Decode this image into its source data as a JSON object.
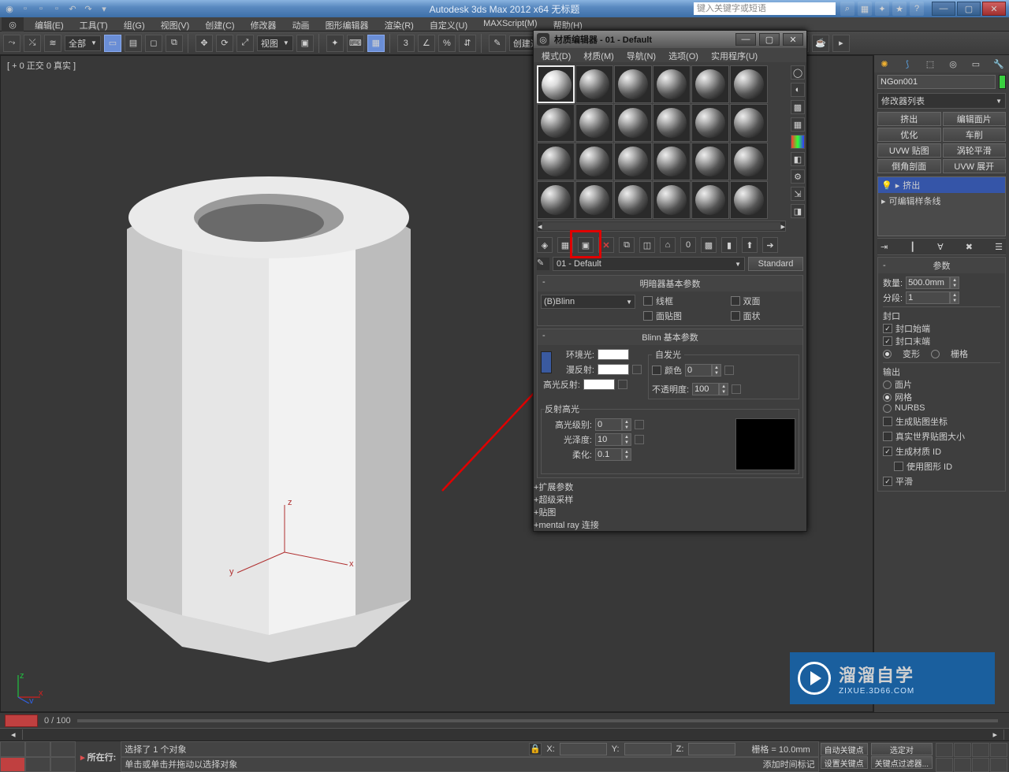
{
  "app": {
    "title": "Autodesk 3ds Max  2012 x64    无标题",
    "search_placeholder": "键入关键字或短语"
  },
  "menu": [
    "编辑(E)",
    "工具(T)",
    "组(G)",
    "视图(V)",
    "创建(C)",
    "修改器",
    "动画",
    "图形编辑器",
    "渲染(R)",
    "自定义(U)",
    "MAXScript(M)",
    "帮助(H)"
  ],
  "toolbar": {
    "all": "全部",
    "view": "视图",
    "create_set": "创建选择集"
  },
  "viewport": {
    "label": "[ + 0 正交 0 真实 ]"
  },
  "right": {
    "obj_name": "NGon001",
    "mod_list": "修改器列表",
    "btn_extrude": "挤出",
    "btn_editface": "编辑面片",
    "btn_optimize": "优化",
    "btn_lathe": "车削",
    "btn_uvwmap": "UVW 贴图",
    "btn_turbosmooth": "涡轮平滑",
    "btn_bevelprof": "倒角剖面",
    "btn_uvwunwrap": "UVW 展开",
    "stack_top": "挤出",
    "stack_base": "可编辑样条线",
    "rollup_params": "参数",
    "amount": "数量:",
    "amount_val": "500.0mm",
    "segs": "分段:",
    "segs_val": "1",
    "cap": "封口",
    "cap_start": "封口始端",
    "cap_end": "封口末端",
    "morph": "变形",
    "grid": "栅格",
    "output": "输出",
    "patch": "面片",
    "mesh": "网格",
    "nurbs": "NURBS",
    "gen_uv": "生成贴图坐标",
    "real_world": "真实世界贴图大小",
    "gen_matid": "生成材质 ID",
    "use_shapeid": "使用图形 ID",
    "smooth": "平滑"
  },
  "mat": {
    "title": "材质编辑器 - 01 - Default",
    "menu": [
      "模式(D)",
      "材质(M)",
      "导航(N)",
      "选项(O)",
      "实用程序(U)"
    ],
    "name": "01 - Default",
    "type": "Standard",
    "roll_shader": "明暗器基本参数",
    "shader": "(B)Blinn",
    "wire": "线框",
    "twoside": "双面",
    "facemap": "面贴图",
    "faceted": "面状",
    "roll_blinn": "Blinn 基本参数",
    "selfillum": "自发光",
    "color": "颜色",
    "color_val": "0",
    "ambient": "环境光:",
    "diffuse": "漫反射:",
    "specular": "高光反射:",
    "opacity": "不透明度:",
    "opacity_val": "100",
    "spec_hl": "反射高光",
    "spec_level": "高光级别:",
    "spec_level_val": "0",
    "gloss": "光泽度:",
    "gloss_val": "10",
    "soften": "柔化:",
    "soften_val": "0.1",
    "roll_ext": "扩展参数",
    "roll_ss": "超级采样",
    "roll_maps": "贴图",
    "roll_mr": "mental ray 连接"
  },
  "timeline": {
    "range": "0 / 100"
  },
  "status": {
    "selected": "选择了 1 个对象",
    "hint": "单击或单击并拖动以选择对象",
    "grid": "栅格 = 10.0mm",
    "addtime": "添加时间标记",
    "autokey": "自动关键点",
    "setkey": "设置关键点",
    "keyfilter": "关键点过滤器...",
    "sel_pair": "选定对",
    "script": "所在行:"
  },
  "watermark": {
    "big": "溜溜自学",
    "sm": "ZIXUE.3D66.COM"
  }
}
